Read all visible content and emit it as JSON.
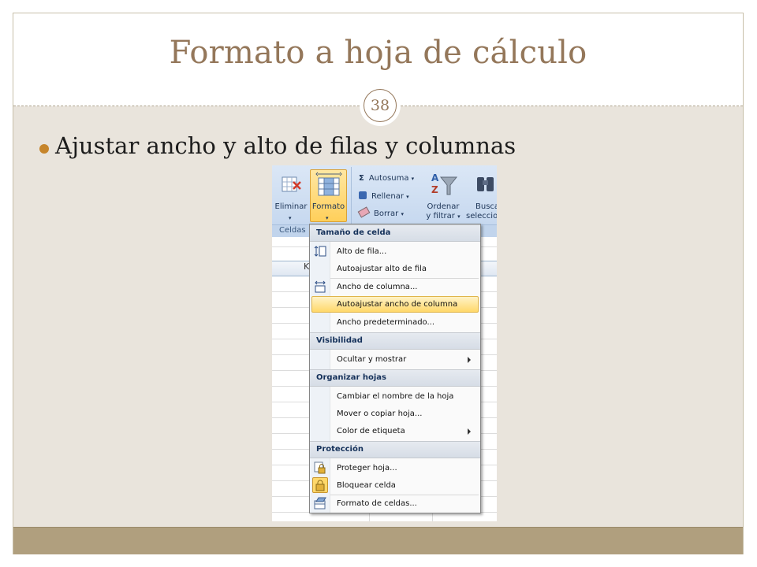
{
  "slide": {
    "title": "Formato a hoja de cálculo",
    "page_number": "38",
    "bullet": "Ajustar ancho y alto de filas y columnas"
  },
  "ribbon": {
    "eliminar": "Eliminar",
    "formato": "Formato",
    "autosuma": "Autosuma",
    "rellenar": "Rellenar",
    "borrar": "Borrar",
    "ordenar_line1": "Ordenar",
    "ordenar_line2": "y filtrar",
    "buscar_line1": "Busca",
    "buscar_line2": "seleccio",
    "group_celdas": "Celdas",
    "column_k": "K"
  },
  "menu": {
    "headers": [
      "Tamaño de celda",
      "Visibilidad",
      "Organizar hojas",
      "Protección"
    ],
    "items": [
      "Alto de fila...",
      "Autoajustar alto de fila",
      "Ancho de columna...",
      "Autoajustar ancho de columna",
      "Ancho predeterminado...",
      "Ocultar y mostrar",
      "Cambiar el nombre de la hoja",
      "Mover o copiar hoja...",
      "Color de etiqueta",
      "Proteger hoja...",
      "Bloquear celda",
      "Formato de celdas..."
    ],
    "highlighted": "Autoajustar ancho de columna"
  },
  "colors": {
    "title": "#94775a",
    "bullet": "#c6852b",
    "body_bg": "#e9e4dc",
    "footer": "#b09f7e",
    "menu_highlight": "#ffd86a"
  }
}
